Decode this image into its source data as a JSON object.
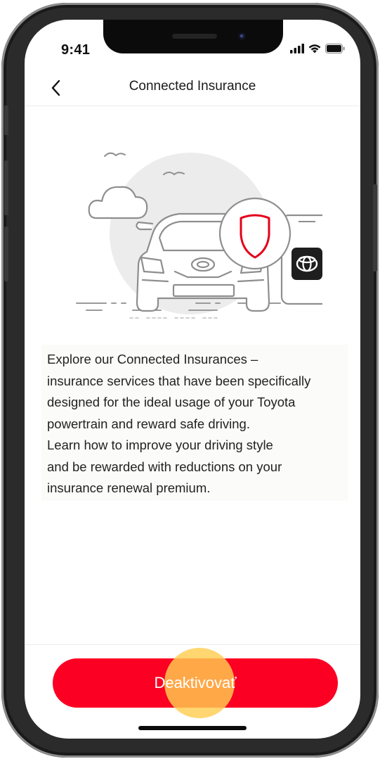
{
  "status_bar": {
    "time": "9:41",
    "icons": [
      "signal-icon",
      "wifi-icon",
      "battery-icon"
    ]
  },
  "header": {
    "back_icon": "chevron-left-icon",
    "title": "Connected Insurance"
  },
  "illustration": {
    "description_icons": [
      "car-icon",
      "shield-icon",
      "toyota-logo-icon",
      "cloud-icon",
      "bird-icon"
    ],
    "shield_color": "#e3001b"
  },
  "description": {
    "lines": [
      "Explore our Connected Insurances –",
      "insurance services that have been specifically",
      "designed for the ideal usage of your Toyota",
      "powertrain and reward safe driving.",
      "Learn how to improve your driving style",
      "and be rewarded with reductions on your",
      "insurance renewal premium."
    ]
  },
  "footer": {
    "button_label": "Deaktivovať"
  },
  "colors": {
    "accent": "#fb0023",
    "tap_highlight": "#ffcd50"
  }
}
